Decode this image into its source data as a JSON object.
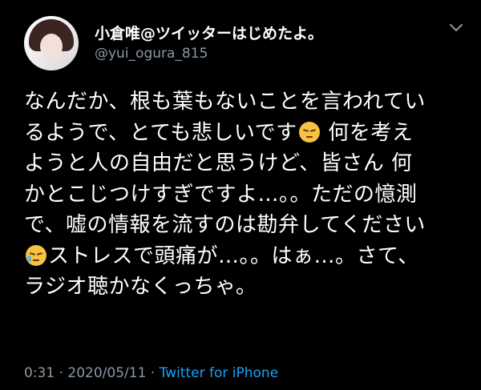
{
  "user": {
    "display_name": "小倉唯@ツイッターはじめたよ。",
    "handle": "@yui_ogura_815"
  },
  "tweet": {
    "lines": [
      {
        "parts": [
          "なんだか、根も葉もないことを言われてい"
        ]
      },
      {
        "parts": [
          "るようで、とても悲しいです",
          " 何を考え"
        ],
        "emoji": "pensive-face-emoji"
      },
      {
        "parts": [
          "ようと人の自由だと思うけど、皆さん 何"
        ]
      },
      {
        "parts": [
          "かとこじつけすぎですよ…。。ただの憶測"
        ]
      },
      {
        "parts": [
          "で、嘘の情報を流すのは勘弁してください"
        ]
      },
      {
        "parts": [
          "",
          "ストレスで頭痛が…。。はぁ…。さて、"
        ],
        "emoji": "sad-but-relieved-face-emoji"
      },
      {
        "parts": [
          "ラジオ聴かなくっちゃ。"
        ]
      }
    ]
  },
  "footer": {
    "time": "0:31",
    "separator": "·",
    "date": "2020/05/11",
    "source": "Twitter for iPhone"
  },
  "colors": {
    "background": "#000000",
    "text": "#ffffff",
    "secondary": "#8b98a5",
    "link": "#1da1f2"
  }
}
